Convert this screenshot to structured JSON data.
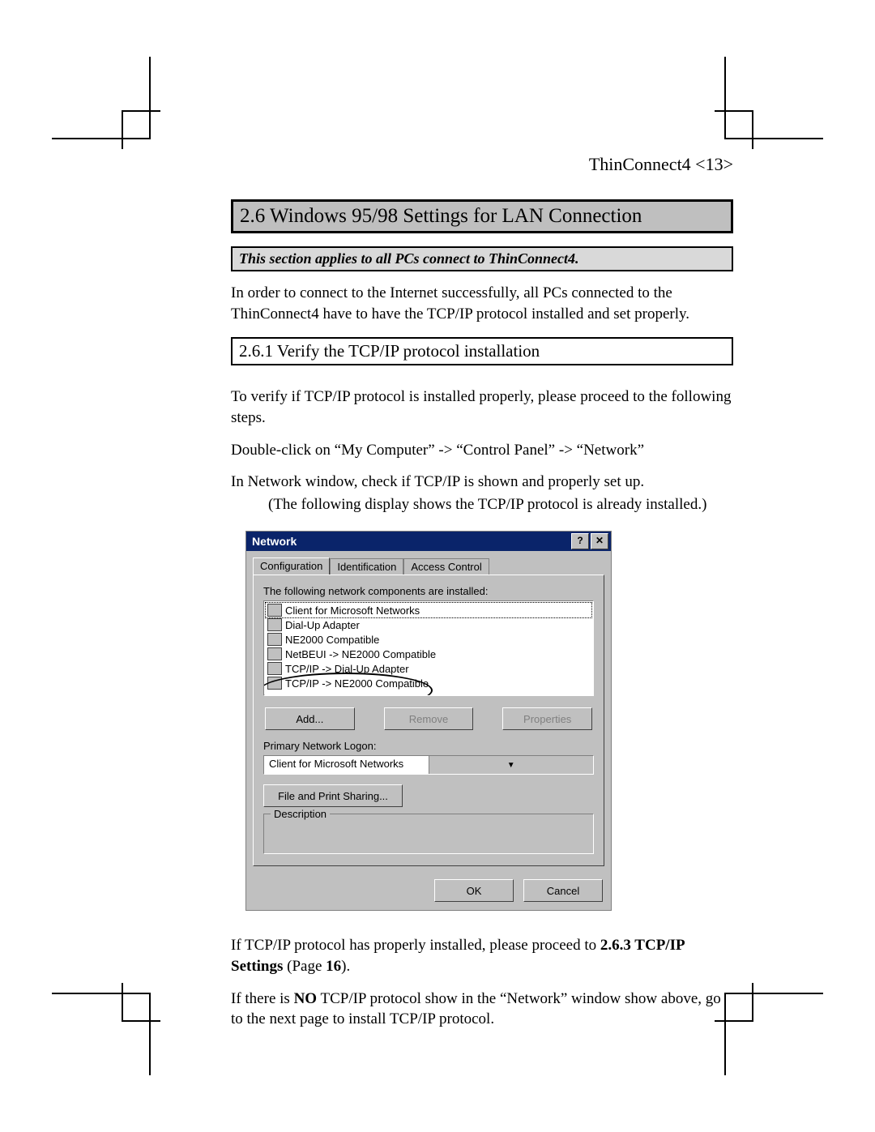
{
  "header": "ThinConnect4 <13>",
  "section_title": "2.6 Windows 95/98 Settings for LAN Connection",
  "sub_note": "This section applies to all PCs connect to ThinConnect4.",
  "para1": "In order to connect to the Internet successfully, all PCs connected to the ThinConnect4 have to have the TCP/IP protocol installed and set properly.",
  "sub_section": "2.6.1 Verify the TCP/IP protocol installation",
  "para2": "To verify if TCP/IP protocol is installed properly, please proceed to the following steps.",
  "para3": "Double-click on “My Computer” -> “Control Panel” -> “Network”",
  "para4": "In Network window, check if TCP/IP is shown and properly set up.",
  "para4b": "(The following display shows the TCP/IP protocol is already installed.)",
  "dialog": {
    "title": "Network",
    "help": "?",
    "close": "✕",
    "tabs": [
      "Configuration",
      "Identification",
      "Access Control"
    ],
    "list_label": "The following network components are installed:",
    "items": [
      "Client for Microsoft Networks",
      "Dial-Up Adapter",
      "NE2000 Compatible",
      "NetBEUI -> NE2000 Compatible",
      "TCP/IP -> Dial-Up Adapter",
      "TCP/IP -> NE2000 Compatible"
    ],
    "add": "Add...",
    "remove": "Remove",
    "properties": "Properties",
    "logon_label": "Primary Network Logon:",
    "logon_value": "Client for Microsoft Networks",
    "fps": "File and Print Sharing...",
    "desc": "Description",
    "ok": "OK",
    "cancel": "Cancel"
  },
  "para5a": "If TCP/IP protocol has properly installed, please proceed to ",
  "para5b": "2.6.3 TCP/IP Settings",
  "para5c": " (Page ",
  "para5d": "16",
  "para5e": ").",
  "para6a": "If there is ",
  "para6b": "NO",
  "para6c": " TCP/IP protocol show in the “Network” window show above, go to the next page to install TCP/IP protocol."
}
